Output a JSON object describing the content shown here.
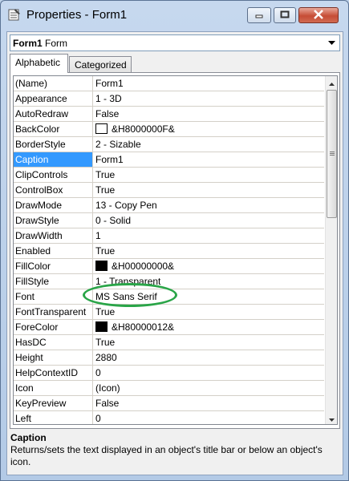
{
  "window": {
    "title": "Properties - Form1"
  },
  "object_selector": {
    "name": "Form1",
    "type": "Form"
  },
  "tabs": [
    {
      "label": "Alphabetic",
      "selected": true
    },
    {
      "label": "Categorized",
      "selected": false
    }
  ],
  "properties": [
    {
      "name": "(Name)",
      "value": "Form1"
    },
    {
      "name": "Appearance",
      "value": "1 - 3D"
    },
    {
      "name": "AutoRedraw",
      "value": "False"
    },
    {
      "name": "BackColor",
      "value": "&H8000000F&",
      "swatch": "#ffffff"
    },
    {
      "name": "BorderStyle",
      "value": "2 - Sizable"
    },
    {
      "name": "Caption",
      "value": "Form1",
      "selected": true
    },
    {
      "name": "ClipControls",
      "value": "True"
    },
    {
      "name": "ControlBox",
      "value": "True"
    },
    {
      "name": "DrawMode",
      "value": "13 - Copy Pen"
    },
    {
      "name": "DrawStyle",
      "value": "0 - Solid"
    },
    {
      "name": "DrawWidth",
      "value": "1"
    },
    {
      "name": "Enabled",
      "value": "True"
    },
    {
      "name": "FillColor",
      "value": "&H00000000&",
      "swatch": "#000000"
    },
    {
      "name": "FillStyle",
      "value": "1 - Transparent"
    },
    {
      "name": "Font",
      "value": "MS Sans Serif",
      "highlighted": true
    },
    {
      "name": "FontTransparent",
      "value": "True"
    },
    {
      "name": "ForeColor",
      "value": "&H80000012&",
      "swatch": "#000000"
    },
    {
      "name": "HasDC",
      "value": "True"
    },
    {
      "name": "Height",
      "value": "2880"
    },
    {
      "name": "HelpContextID",
      "value": "0"
    },
    {
      "name": "Icon",
      "value": "(Icon)"
    },
    {
      "name": "KeyPreview",
      "value": "False"
    },
    {
      "name": "Left",
      "value": "0"
    }
  ],
  "description": {
    "title": "Caption",
    "text": "Returns/sets the text displayed in an object's title bar or below an object's icon."
  },
  "colors": {
    "selection": "#3399ff",
    "highlight_ring": "#2aa548"
  }
}
